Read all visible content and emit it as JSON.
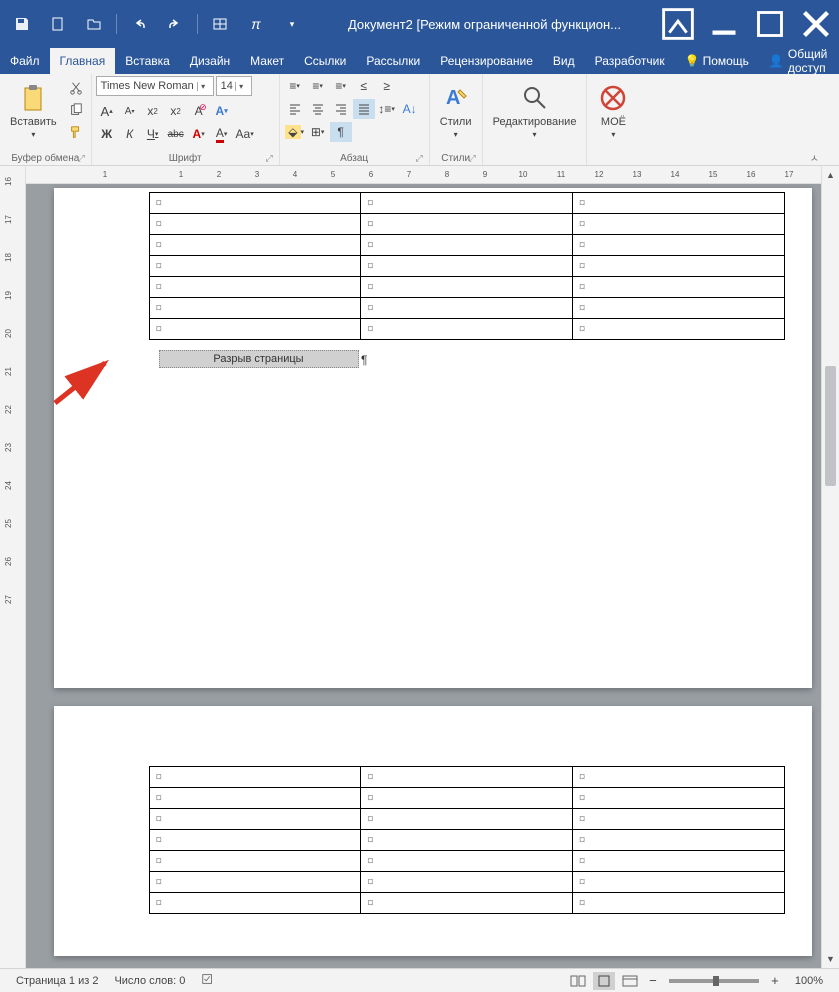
{
  "titlebar": {
    "title": "Документ2 [Режим ограниченной функцион..."
  },
  "tabs": {
    "file": "Файл",
    "home": "Главная",
    "insert": "Вставка",
    "design": "Дизайн",
    "layout": "Макет",
    "references": "Ссылки",
    "mailings": "Рассылки",
    "review": "Рецензирование",
    "view": "Вид",
    "developer": "Разработчик",
    "help": "Помощь",
    "share": "Общий доступ"
  },
  "ribbon": {
    "clipboard": {
      "label": "Буфер обмена",
      "paste": "Вставить"
    },
    "font": {
      "label": "Шрифт",
      "name": "Times New Roman",
      "size": "14",
      "bold": "Ж",
      "italic": "К",
      "underline": "Ч",
      "strike": "abc",
      "aa": "Aa"
    },
    "paragraph": {
      "label": "Абзац"
    },
    "styles": {
      "label": "Стили",
      "btn": "Стили"
    },
    "editing": {
      "label": "Редактирование"
    },
    "moe": {
      "label": "МОЁ"
    }
  },
  "document": {
    "cell_mark": "¤",
    "page_break": "Разрыв страницы",
    "pilcrow": "¶"
  },
  "statusbar": {
    "page": "Страница 1 из 2",
    "words": "Число слов: 0",
    "zoom": "100%"
  },
  "ruler": {
    "h": [
      "1",
      "",
      "1",
      "2",
      "3",
      "4",
      "5",
      "6",
      "7",
      "8",
      "9",
      "10",
      "11",
      "12",
      "13",
      "14",
      "15",
      "16",
      "17"
    ],
    "v": [
      "16",
      "17",
      "18",
      "19",
      "20",
      "21",
      "22",
      "23",
      "24",
      "25",
      "26",
      "27"
    ]
  }
}
